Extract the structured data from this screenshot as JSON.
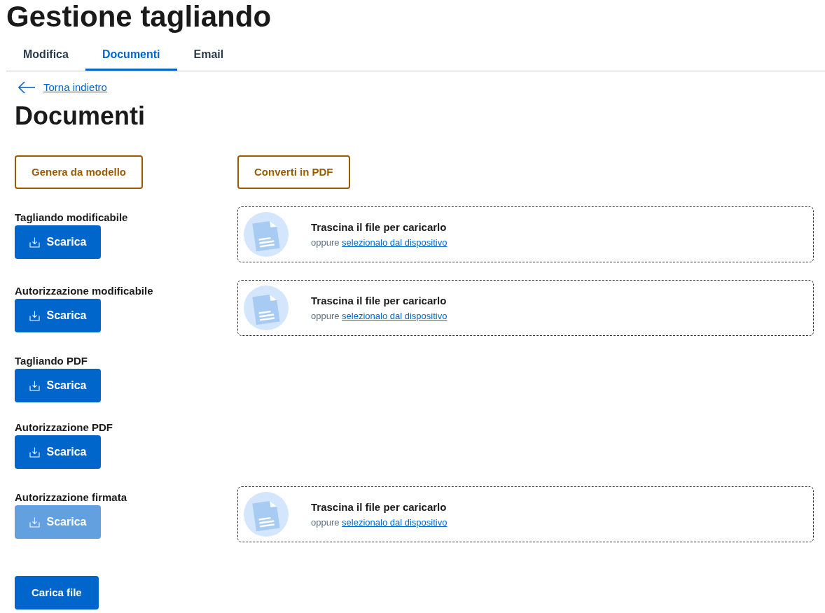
{
  "page_title": "Gestione tagliando",
  "tabs": [
    {
      "label": "Modifica",
      "selected": false
    },
    {
      "label": "Documenti",
      "selected": true
    },
    {
      "label": "Email",
      "selected": false
    }
  ],
  "back_link": "Torna indietro",
  "section_title": "Documenti",
  "actions": [
    {
      "label": "Genera da modello"
    },
    {
      "label": "Converti in PDF"
    }
  ],
  "documents": [
    {
      "label": "Tagliando modificabile",
      "download": {
        "label": "Scarica",
        "disabled": false
      },
      "dropzone": {
        "title": "Trascina il file per caricarlo",
        "prefix": "oppure",
        "link": "selezionalo dal dispositivo"
      }
    },
    {
      "label": "Autorizzazione modificabile",
      "download": {
        "label": "Scarica",
        "disabled": false
      },
      "dropzone": {
        "title": "Trascina il file per caricarlo",
        "prefix": "oppure",
        "link": "selezionalo dal dispositivo"
      }
    },
    {
      "label": "Tagliando PDF",
      "download": {
        "label": "Scarica",
        "disabled": false
      }
    },
    {
      "label": "Autorizzazione PDF",
      "download": {
        "label": "Scarica",
        "disabled": false
      }
    },
    {
      "label": "Autorizzazione firmata",
      "download": {
        "label": "Scarica",
        "disabled": true
      },
      "dropzone": {
        "title": "Trascina il file per caricarlo",
        "prefix": "oppure",
        "link": "selezionalo dal dispositivo"
      }
    }
  ],
  "upload_button": "Carica file"
}
